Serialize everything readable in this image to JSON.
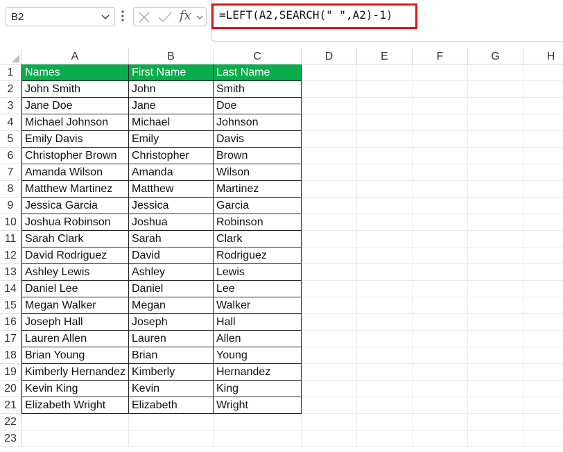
{
  "name_box": {
    "value": "B2"
  },
  "formula_bar": {
    "fx_label": "fx",
    "formula": "=LEFT(A2,SEARCH(\" \",A2)-1)"
  },
  "colors": {
    "header_fill": "#0aad4c",
    "header_text": "#ffffff",
    "highlight_border": "#e0141e"
  },
  "columns": [
    "A",
    "B",
    "C",
    "D",
    "E",
    "F",
    "G",
    "H"
  ],
  "rows": [
    "1",
    "2",
    "3",
    "4",
    "5",
    "6",
    "7",
    "8",
    "9",
    "10",
    "11",
    "12",
    "13",
    "14",
    "15",
    "16",
    "17",
    "18",
    "19",
    "20",
    "21",
    "22",
    "23"
  ],
  "table": {
    "headers": [
      "Names",
      "First Name",
      "Last Name"
    ],
    "rows": [
      [
        "John Smith",
        "John",
        "Smith"
      ],
      [
        "Jane Doe",
        "Jane",
        "Doe"
      ],
      [
        "Michael Johnson",
        "Michael",
        "Johnson"
      ],
      [
        "Emily Davis",
        "Emily",
        "Davis"
      ],
      [
        "Christopher Brown",
        "Christopher",
        "Brown"
      ],
      [
        "Amanda Wilson",
        "Amanda",
        "Wilson"
      ],
      [
        "Matthew Martinez",
        "Matthew",
        "Martinez"
      ],
      [
        "Jessica Garcia",
        "Jessica",
        "Garcia"
      ],
      [
        "Joshua Robinson",
        "Joshua",
        "Robinson"
      ],
      [
        "Sarah Clark",
        "Sarah",
        "Clark"
      ],
      [
        "David Rodriguez",
        "David",
        "Rodriguez"
      ],
      [
        "Ashley Lewis",
        "Ashley",
        "Lewis"
      ],
      [
        "Daniel Lee",
        "Daniel",
        "Lee"
      ],
      [
        "Megan Walker",
        "Megan",
        "Walker"
      ],
      [
        "Joseph Hall",
        "Joseph",
        "Hall"
      ],
      [
        "Lauren Allen",
        "Lauren",
        "Allen"
      ],
      [
        "Brian Young",
        "Brian",
        "Young"
      ],
      [
        "Kimberly Hernandez",
        "Kimberly",
        "Hernandez"
      ],
      [
        "Kevin King",
        "Kevin",
        "King"
      ],
      [
        "Elizabeth Wright",
        "Elizabeth",
        "Wright"
      ]
    ]
  }
}
